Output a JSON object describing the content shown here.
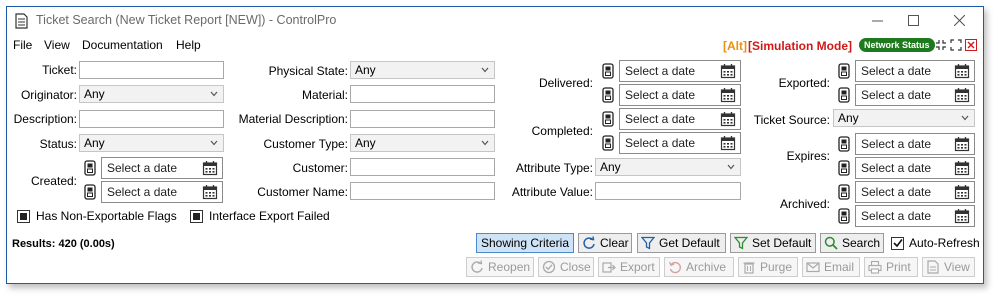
{
  "window": {
    "title": "Ticket Search (New Ticket Report [NEW]) - ControlPro",
    "icons": [
      "document-icon",
      "minimize-icon",
      "maximize-icon",
      "close-icon"
    ]
  },
  "menu": {
    "items": [
      "File",
      "View",
      "Documentation",
      "Help"
    ],
    "alt_label": "[Alt]",
    "simulation_label": "[Simulation Mode]",
    "network_status": "Network Status",
    "colors": {
      "alt": "#e8920f",
      "simulation": "#d01919",
      "network": "#1f7a1f"
    }
  },
  "form": {
    "ticket_label": "Ticket:",
    "originator_label": "Originator:",
    "originator_value": "Any",
    "description_label": "Description:",
    "status_label": "Status:",
    "status_value": "Any",
    "created_label": "Created:",
    "created_from": "Select a date",
    "created_to": "Select a date",
    "physical_state_label": "Physical State:",
    "physical_state_value": "Any",
    "material_label": "Material:",
    "material_description_label": "Material Description:",
    "customer_type_label": "Customer Type:",
    "customer_type_value": "Any",
    "customer_label": "Customer:",
    "customer_name_label": "Customer Name:",
    "delivered_label": "Delivered:",
    "delivered_from": "Select a date",
    "delivered_to": "Select a date",
    "completed_label": "Completed:",
    "completed_from": "Select a date",
    "completed_to": "Select a date",
    "attribute_type_label": "Attribute Type:",
    "attribute_type_value": "Any",
    "attribute_value_label": "Attribute Value:",
    "exported_label": "Exported:",
    "exported_from": "Select a date",
    "exported_to": "Select a date",
    "ticket_source_label": "Ticket Source:",
    "ticket_source_value": "Any",
    "expires_label": "Expires:",
    "expires_from": "Select a date",
    "expires_to": "Select a date",
    "archived_label": "Archived:",
    "archived_from": "Select a date",
    "archived_to": "Select a date",
    "has_non_exportable_label": "Has Non-Exportable Flags",
    "interface_export_failed_label": "Interface Export Failed"
  },
  "results": "Results: 420 (0.00s)",
  "actions": {
    "showing_criteria": "Showing Criteria",
    "clear": "Clear",
    "get_default": "Get Default",
    "set_default": "Set Default",
    "search": "Search",
    "auto_refresh": "Auto-Refresh",
    "auto_refresh_checked": true
  },
  "ticket_actions": {
    "reopen": "Reopen",
    "close": "Close",
    "export": "Export",
    "archive": "Archive",
    "purge": "Purge",
    "email": "Email",
    "print": "Print",
    "view": "View"
  }
}
